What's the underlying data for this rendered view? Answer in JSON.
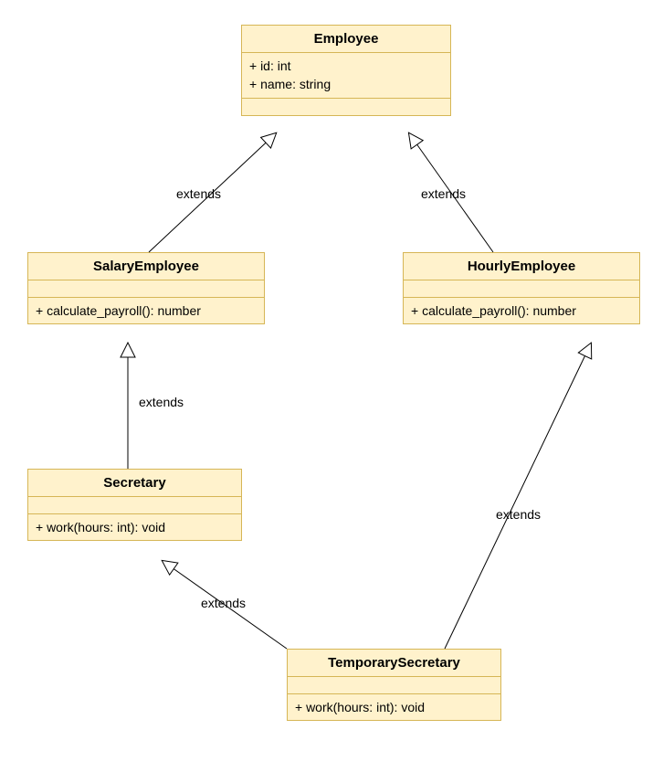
{
  "classes": {
    "employee": {
      "name": "Employee",
      "attrs": [
        "+ id: int",
        "+ name: string"
      ],
      "methods": []
    },
    "salaryEmployee": {
      "name": "SalaryEmployee",
      "attrs": [],
      "methods": [
        "+ calculate_payroll(): number"
      ]
    },
    "hourlyEmployee": {
      "name": "HourlyEmployee",
      "attrs": [],
      "methods": [
        "+ calculate_payroll(): number"
      ]
    },
    "secretary": {
      "name": "Secretary",
      "attrs": [],
      "methods": [
        "+ work(hours: int): void"
      ]
    },
    "temporarySecretary": {
      "name": "TemporarySecretary",
      "attrs": [],
      "methods": [
        "+ work(hours: int): void"
      ]
    }
  },
  "relations": {
    "salEmp_emp": "extends",
    "hrEmp_emp": "extends",
    "sec_salEmp": "extends",
    "tmp_sec": "extends",
    "tmp_hrEmp": "extends"
  }
}
